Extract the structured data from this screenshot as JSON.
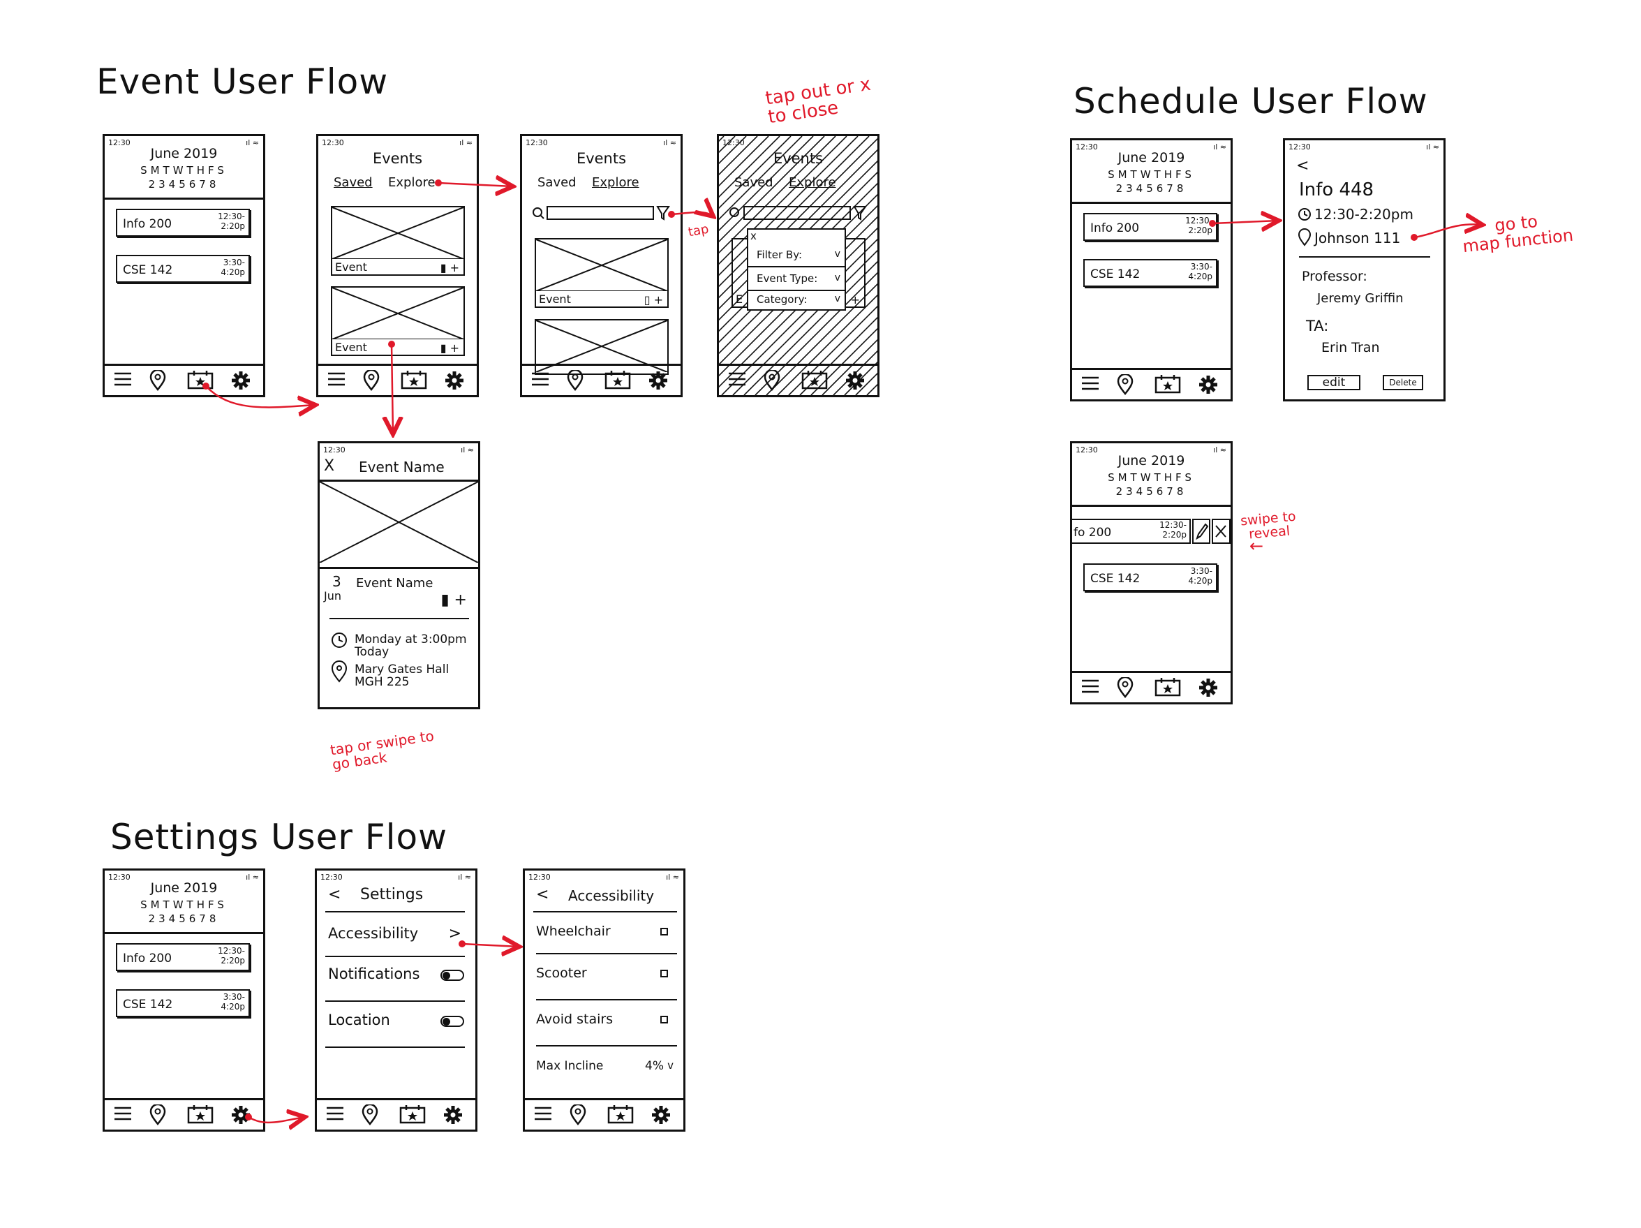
{
  "titles": {
    "event": "Event User Flow",
    "schedule": "Schedule User Flow",
    "settings": "Settings User Flow"
  },
  "annotations": {
    "tap_close": "tap out or x\nto close",
    "tap": "tap",
    "go_back": "tap or swipe to\ngo back",
    "map": "go to\nmap function",
    "reveal": "swipe to\nreveal",
    "reveal_arrow": "←"
  },
  "status": {
    "time": "12:30",
    "signal": "ıl ≈"
  },
  "calendar": {
    "month": "June 2019",
    "days": "SMTWTHFS",
    "dates": "2345678"
  },
  "classes": [
    {
      "name": "Info 200",
      "time": "12:30-\n2:20p"
    },
    {
      "name": "CSE 142",
      "time": "3:30-\n4:20p"
    }
  ],
  "swiped": {
    "name": "fo 200",
    "time": "12:30-\n2:20p",
    "edit_icon": "pencil",
    "delete_icon": "x"
  },
  "events": {
    "title": "Events",
    "saved": "Saved",
    "explore": "Explore",
    "card": "Event",
    "card_icons": "▮ +",
    "card_icons_outline": "▯ +"
  },
  "filter": {
    "close": "x",
    "items": [
      "Filter By:",
      "Event Type:",
      "Category:"
    ],
    "chev": "v",
    "peek": "E",
    "peek_icon": "+"
  },
  "event_detail": {
    "close": "X",
    "name": "Event Name",
    "date_day": "3",
    "date_month": "Jun",
    "icons": "▮ +",
    "time": "Monday at 3:00pm",
    "time_sub": "Today",
    "place": "Mary Gates Hall",
    "place_sub": "MGH 225"
  },
  "class_detail": {
    "back": "<",
    "name": "Info 448",
    "time": "12:30-2:20pm",
    "place": "Johnson 111",
    "prof_label": "Professor:",
    "prof": "Jeremy Griffin",
    "ta_label": "TA:",
    "ta": "Erin Tran",
    "edit": "edit",
    "delete": "Delete"
  },
  "settings": {
    "back": "<",
    "title": "Settings",
    "items": [
      "Accessibility",
      "Notifications",
      "Location"
    ],
    "chev": ">"
  },
  "accessibility": {
    "back": "<",
    "title": "Accessibility",
    "items": [
      "Wheelchair",
      "Scooter",
      "Avoid stairs"
    ],
    "incline_label": "Max Incline",
    "incline_value": "4%",
    "incline_chev": "v"
  },
  "tabbar_icons": [
    "menu-icon",
    "map-pin-icon",
    "calendar-star-icon",
    "gear-icon"
  ],
  "colors": {
    "ink": "#111111",
    "annotation": "#e0192a"
  }
}
